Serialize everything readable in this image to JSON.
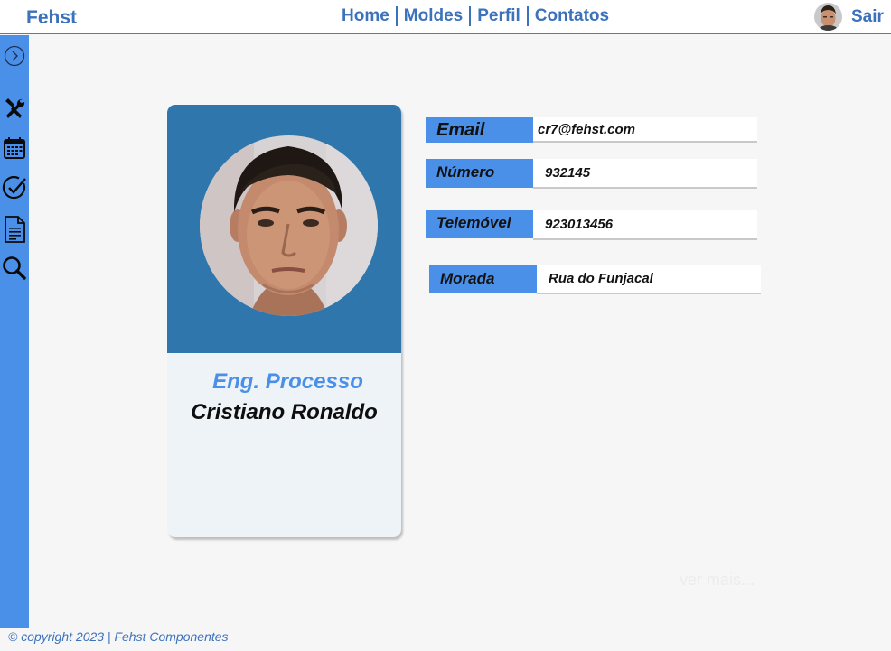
{
  "app": {
    "brand": "Fehst",
    "logout_label": "Sair"
  },
  "nav": {
    "items": [
      {
        "label": "Home"
      },
      {
        "label": "Moldes"
      },
      {
        "label": "Perfil"
      },
      {
        "label": "Contatos"
      }
    ]
  },
  "sidebar": {
    "items": [
      {
        "icon": "chevron-right-icon"
      },
      {
        "icon": "tools-icon"
      },
      {
        "icon": "calendar-icon"
      },
      {
        "icon": "check-circle-icon"
      },
      {
        "icon": "document-icon"
      },
      {
        "icon": "search-icon"
      }
    ]
  },
  "profile": {
    "role": "Eng. Processo",
    "name": "Cristiano Ronaldo"
  },
  "info": {
    "email_label": "Email",
    "email_value": "cr7@fehst.com",
    "numero_label": "Número",
    "numero_value": "932145",
    "telemovel_label": "Telemóvel",
    "telemovel_value": "923013456",
    "morada_label": "Morada",
    "morada_value": "Rua do Funjacal"
  },
  "ver_mais": "ver mais...",
  "footer": "© copyright 2023 | Fehst Componentes",
  "colors": {
    "accent": "#4a90e8",
    "brand_text": "#3c72bc",
    "card_header": "#2e76ab",
    "card_body": "#eef3f8",
    "background": "#f6f6f6"
  }
}
